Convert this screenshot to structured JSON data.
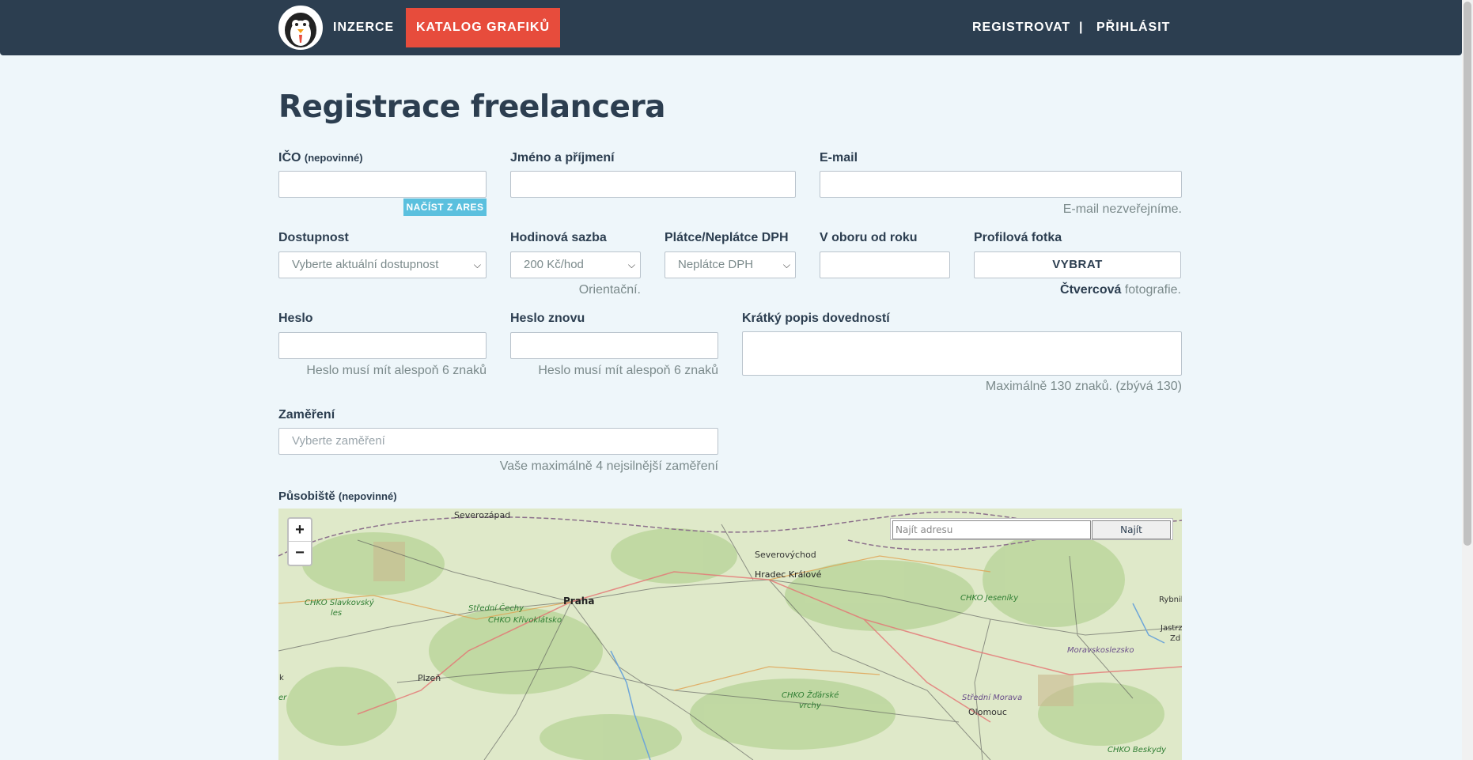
{
  "navbar": {
    "inzerce": "INZERCE",
    "katalog": "KATALOG GRAFIKŮ",
    "registrovat": "REGISTROVAT",
    "separator": "|",
    "prihlasit": "PŘIHLÁSIT"
  },
  "page_title": "Registrace freelancera",
  "form": {
    "ico": {
      "label": "IČO",
      "label_note": "(nepovinné)",
      "ares_button": "NAČÍST Z ARES"
    },
    "jmeno": {
      "label": "Jméno a příjmení"
    },
    "email": {
      "label": "E-mail",
      "help": "E-mail nezveřejníme."
    },
    "dostupnost": {
      "label": "Dostupnost",
      "value": "Vyberte aktuální dostupnost"
    },
    "sazba": {
      "label": "Hodinová sazba",
      "value": "200 Kč/hod",
      "help": "Orientační."
    },
    "dph": {
      "label": "Plátce/Neplátce DPH",
      "value": "Neplátce DPH"
    },
    "rok": {
      "label": "V oboru od roku"
    },
    "fotka": {
      "label": "Profilová fotka",
      "button": "VYBRAT",
      "help_bold": "Čtvercová",
      "help_rest": " fotografie."
    },
    "heslo": {
      "label": "Heslo",
      "help": "Heslo musí mít alespoň 6 znaků"
    },
    "heslo2": {
      "label": "Heslo znovu",
      "help": "Heslo musí mít alespoň 6 znaků"
    },
    "popis": {
      "label": "Krátký popis dovedností",
      "help": "Maximálně 130 znaků. (zbývá 130)"
    },
    "zamereni": {
      "label": "Zaměření",
      "placeholder": "Vyberte zaměření",
      "help": "Vaše maximálně 4 nejsilnější zaměření"
    },
    "pusobiste": {
      "label": "Působiště",
      "label_note": "(nepovinné)"
    }
  },
  "map": {
    "zoom_in": "+",
    "zoom_out": "−",
    "search_placeholder": "Najít adresu",
    "search_button": "Najít",
    "labels": {
      "severozapad": "Severozápad",
      "severovychod": "Severovýchod",
      "hradec": "Hradec Králové",
      "praha": "Praha",
      "stredni_cechy": "Střední Čechy",
      "krivoklatsko": "CHKO Křivoklátsko",
      "slavkovsky_1": "CHKO Slavkovský",
      "slavkovsky_2": "les",
      "jeseniky": "CHKO Jeseníky",
      "rybnik": "Rybnik",
      "jastrz": "Jastrz",
      "zd": "Zd",
      "moravskoslezsko": "Moravskoslezsko",
      "plzen": "Plzeň",
      "zdarske_1": "CHKO Žďárské",
      "zdarske_2": "vrchy",
      "stredni_morava": "Střední Morava",
      "olomouc": "Olomouc",
      "beskydy": "CHKO Beskydy",
      "k": "k",
      "er": "er"
    }
  }
}
